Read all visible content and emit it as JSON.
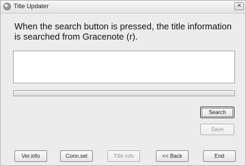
{
  "window": {
    "title": "Title Updater",
    "close_label": "✕"
  },
  "message": "When the search button is pressed, the title information is searched from Gracenote (r).",
  "result_text": "",
  "progress": {
    "fraction": 0
  },
  "buttons": {
    "search": "Search",
    "save": "Save",
    "ver_info": "Ver.info",
    "conn_set": "Conn.set",
    "title_info": "Title info",
    "back": "<< Back",
    "end": "End"
  }
}
